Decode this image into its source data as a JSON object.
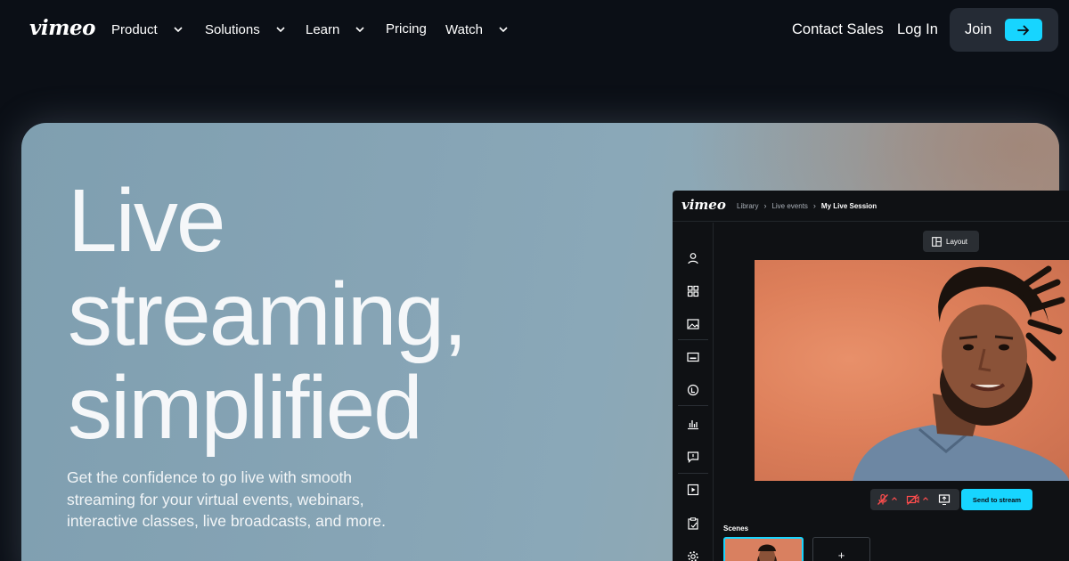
{
  "nav": {
    "logo": "vimeo",
    "items": [
      {
        "label": "Product",
        "has_menu": true
      },
      {
        "label": "Solutions",
        "has_menu": true
      },
      {
        "label": "Learn",
        "has_menu": true
      },
      {
        "label": "Pricing",
        "has_menu": false
      },
      {
        "label": "Watch",
        "has_menu": true
      }
    ],
    "contact_sales": "Contact Sales",
    "log_in": "Log In",
    "join": "Join",
    "accent": "#17d5ff"
  },
  "hero": {
    "headline": [
      "Live",
      "streaming,",
      "simplified"
    ],
    "subtext": "Get the confidence to go live with smooth streaming for your virtual events, webinars, interactive classes, live broadcasts, and more."
  },
  "app": {
    "logo": "vimeo",
    "breadcrumbs": [
      "Library",
      "Live events",
      "My Live Session"
    ],
    "layout_button": "Layout",
    "send_button": "Send to stream",
    "scenes_label": "Scenes",
    "add_scene": "+",
    "sidebar_icons": [
      "person-icon",
      "grid-icon",
      "image-icon",
      "caption-icon",
      "logo-icon",
      "chart-icon",
      "comment-icon",
      "play-box-icon",
      "clipboard-icon",
      "settings-icon"
    ]
  }
}
